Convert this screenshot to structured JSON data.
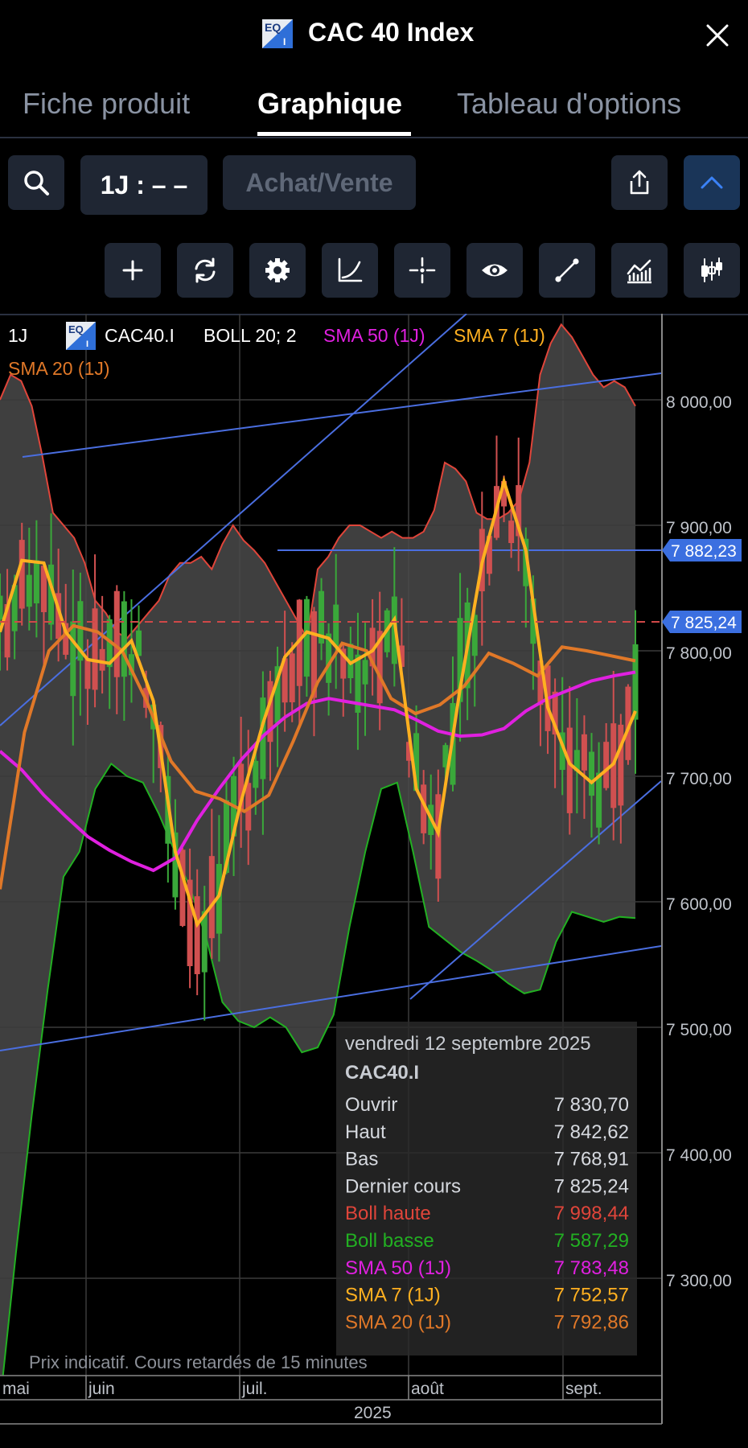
{
  "header": {
    "logo_text": "EQ",
    "logo_sub": "I",
    "title": "CAC 40 Index",
    "close_icon": "close-icon"
  },
  "tabs": [
    {
      "label": "Fiche produit",
      "active": false
    },
    {
      "label": "Graphique",
      "active": true
    },
    {
      "label": "Tableau d'options",
      "active": false
    }
  ],
  "toolbar": {
    "search_icon": "search-icon",
    "timeframe_label": "1J : – –",
    "trade_label": "Achat/Vente",
    "share_icon": "share-icon",
    "collapse_icon": "chevron-up-icon",
    "accent": "#3b82f6"
  },
  "tools": [
    {
      "icon": "plus-icon"
    },
    {
      "icon": "refresh-icon"
    },
    {
      "icon": "gear-icon"
    },
    {
      "icon": "curve-icon"
    },
    {
      "icon": "crosshair-icon"
    },
    {
      "icon": "eye-icon"
    },
    {
      "icon": "line-draw-icon"
    },
    {
      "icon": "indicators-icon"
    },
    {
      "icon": "candlestick-icon"
    }
  ],
  "legend": {
    "interval": "1J",
    "symbol": "CAC40.I",
    "boll": "BOLL 20; 2",
    "sma50": "SMA 50 (1J)",
    "sma7": "SMA 7 (1J)",
    "sma20": "SMA 20 (1J)"
  },
  "colors": {
    "boll_upper": "#e0453a",
    "boll_lower": "#22b022",
    "sma50": "#e020e0",
    "sma7": "#ffb020",
    "sma20": "#e07828",
    "candle_up": "#3aa83a",
    "candle_down": "#d05050",
    "trendline": "#4a6ee0"
  },
  "chart_data": {
    "type": "candlestick",
    "ylim": [
      7200,
      8100
    ],
    "y_ticks": [
      "8 000,00",
      "7 900,00",
      "7 800,00",
      "7 700,00",
      "7 600,00",
      "7 500,00",
      "7 400,00",
      "7 300,00"
    ],
    "x_ticks": [
      "mai",
      "juin",
      "juil.",
      "août",
      "sept."
    ],
    "year_label": "2025",
    "price_tags": [
      {
        "label": "7 882,23",
        "value": 7882.23
      },
      {
        "label": "7 825,24",
        "value": 7825.24
      }
    ],
    "tooltip": {
      "date": "vendredi 12 septembre 2025",
      "symbol": "CAC40.I",
      "rows": [
        {
          "label": "Ouvrir",
          "value": "7 830,70",
          "color": "#d6d9df"
        },
        {
          "label": "Haut",
          "value": "7 842,62",
          "color": "#d6d9df"
        },
        {
          "label": "Bas",
          "value": "7 768,91",
          "color": "#d6d9df"
        },
        {
          "label": "Dernier cours",
          "value": "7 825,24",
          "color": "#d6d9df"
        },
        {
          "label": "Boll haute",
          "value": "7 998,44",
          "color": "#e0453a"
        },
        {
          "label": "Boll basse",
          "value": "7 587,29",
          "color": "#22b022"
        },
        {
          "label": "SMA 50 (1J)",
          "value": "7 783,48",
          "color": "#e020e0"
        },
        {
          "label": "SMA 7 (1J)",
          "value": "7 752,57",
          "color": "#ffb020"
        },
        {
          "label": "SMA 20 (1J)",
          "value": "7 792,86",
          "color": "#e07828"
        }
      ]
    },
    "footnote": "Prix indicatif. Cours retardés de 15 minutes",
    "boll_upper": [
      8000,
      8020,
      8015,
      7995,
      7955,
      7910,
      7900,
      7890,
      7870,
      7840,
      7830,
      7815,
      7810,
      7820,
      7830,
      7840,
      7860,
      7870,
      7870,
      7875,
      7865,
      7885,
      7900,
      7888,
      7880,
      7870,
      7855,
      7840,
      7825,
      7810,
      7865,
      7875,
      7890,
      7900,
      7900,
      7895,
      7890,
      7895,
      7890,
      7890,
      7895,
      7912,
      7950,
      7945,
      7935,
      7910,
      7905,
      7905,
      7910,
      7920,
      7950,
      8020,
      8045,
      8060,
      8050,
      8035,
      8020,
      8010,
      8015,
      8010,
      7995
    ],
    "boll_lower": [
      7200,
      7320,
      7430,
      7530,
      7620,
      7640,
      7690,
      7710,
      7700,
      7695,
      7670,
      7640,
      7610,
      7570,
      7520,
      7505,
      7500,
      7508,
      7500,
      7480,
      7484,
      7510,
      7580,
      7640,
      7690,
      7695,
      7640,
      7580,
      7570,
      7560,
      7553,
      7545,
      7535,
      7527,
      7530,
      7568,
      7592,
      7588,
      7584,
      7588,
      7587
    ],
    "sma50": [
      7720,
      7705,
      7685,
      7668,
      7652,
      7641,
      7632,
      7625,
      7635,
      7665,
      7690,
      7713,
      7732,
      7747,
      7758,
      7762,
      7759,
      7756,
      7753,
      7745,
      7736,
      7732,
      7733,
      7738,
      7752,
      7762,
      7769,
      7776,
      7780,
      7783
    ],
    "sma7": [
      7815,
      7872,
      7870,
      7815,
      7793,
      7790,
      7808,
      7760,
      7640,
      7582,
      7605,
      7680,
      7742,
      7795,
      7815,
      7810,
      7790,
      7800,
      7825,
      7690,
      7655,
      7770,
      7870,
      7935,
      7880,
      7755,
      7710,
      7695,
      7710,
      7752
    ],
    "sma20": [
      7610,
      7735,
      7800,
      7820,
      7815,
      7800,
      7760,
      7712,
      7688,
      7682,
      7672,
      7685,
      7728,
      7775,
      7806,
      7800,
      7762,
      7750,
      7757,
      7772,
      7798,
      7790,
      7780,
      7803,
      7800,
      7796,
      7792
    ]
  }
}
